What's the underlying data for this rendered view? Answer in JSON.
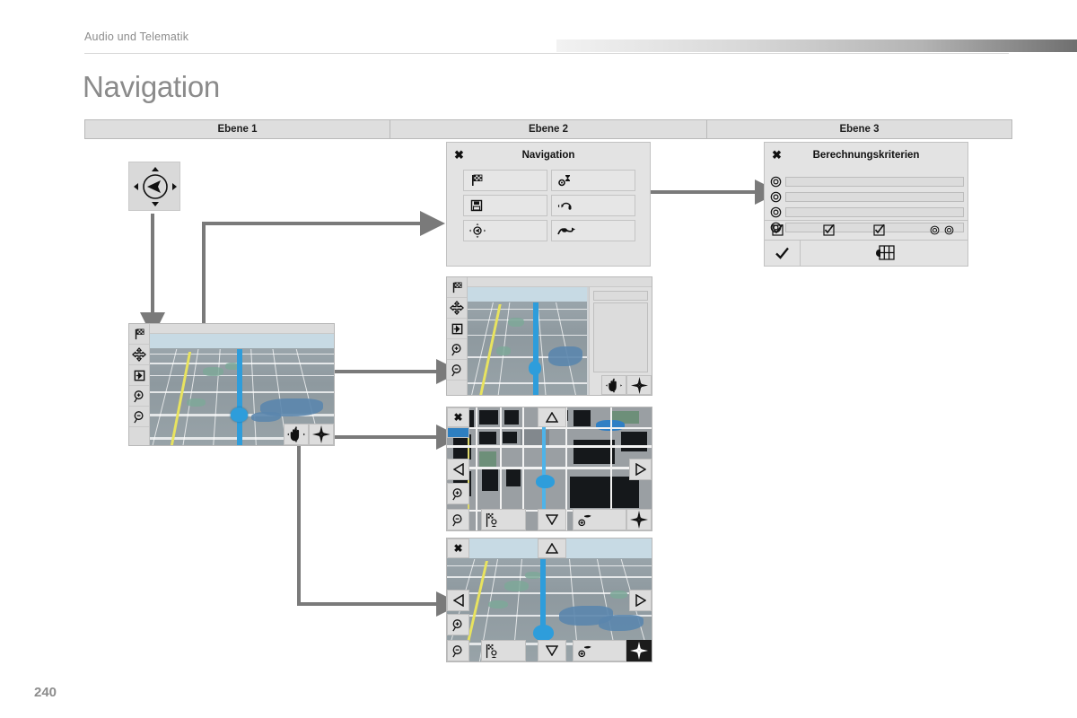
{
  "page": {
    "running_head": "Audio und Telematik",
    "title": "Navigation",
    "number": "240"
  },
  "level_table": {
    "columns": [
      {
        "label": "Ebene 1"
      },
      {
        "label": "Ebene 2"
      },
      {
        "label": "Ebene 3"
      }
    ]
  },
  "joystick": {
    "name": "compass-joystick",
    "icon": "compass-pointer-icon"
  },
  "nav_dialog": {
    "title": "Navigation",
    "close_label": "✖",
    "buttons": [
      {
        "icon": "checkered-flag-icon",
        "label": ""
      },
      {
        "icon": "calculation-criteria-icon",
        "label": ""
      },
      {
        "icon": "floppy-save-icon",
        "label": ""
      },
      {
        "icon": "traffic-headset-icon",
        "label": ""
      },
      {
        "icon": "gps-compass-icon",
        "label": ""
      },
      {
        "icon": "route-road-icon",
        "label": ""
      }
    ]
  },
  "calc_dialog": {
    "title": "Berechnungskriterien",
    "close_label": "✖",
    "option_rows": [
      {
        "icon": "radio-button-icon",
        "value": ""
      },
      {
        "icon": "radio-button-icon",
        "value": ""
      },
      {
        "icon": "radio-button-icon",
        "value": ""
      },
      {
        "icon": "radio-button-icon",
        "value": ""
      }
    ],
    "toggle_icons": [
      {
        "icon": "checkbox-checked-icon"
      },
      {
        "icon": "checkbox-checked-icon"
      },
      {
        "icon": "checkbox-checked-icon"
      }
    ],
    "radio_icons": [
      {
        "icon": "radio-button-icon"
      },
      {
        "icon": "radio-button-icon"
      }
    ],
    "footer": {
      "confirm_icon": "checkmark-icon",
      "map_icon": "map-grid-hand-icon"
    }
  },
  "maps": {
    "main_3d": {
      "name": "map-screen-3d-main",
      "sidebar": [
        {
          "icon": "checkered-flag-icon"
        },
        {
          "icon": "move-cross-icon"
        },
        {
          "icon": "exit-arrow-icon"
        },
        {
          "icon": "zoom-in-icon"
        },
        {
          "icon": "zoom-out-icon"
        }
      ],
      "corner_buttons": [
        {
          "icon": "hand-pan-icon"
        },
        {
          "icon": "compass-rose-icon"
        }
      ]
    },
    "split_3d": {
      "name": "map-screen-3d-split",
      "sidebar": [
        {
          "icon": "checkered-flag-icon"
        },
        {
          "icon": "move-cross-icon"
        },
        {
          "icon": "exit-arrow-icon"
        },
        {
          "icon": "zoom-in-icon"
        },
        {
          "icon": "zoom-out-icon"
        }
      ],
      "corner_buttons": [
        {
          "icon": "hand-pan-icon"
        },
        {
          "icon": "compass-rose-icon"
        }
      ]
    },
    "pan_2d": {
      "name": "map-screen-2d-pan",
      "close_label": "✖",
      "sidebar": [
        {
          "icon": "scale-bar-icon"
        },
        {
          "icon": "pan-left-icon"
        },
        {
          "icon": "zoom-in-icon"
        },
        {
          "icon": "zoom-out-icon"
        }
      ],
      "pan_up_icon": "pan-up-icon",
      "pan_down_icon": "pan-down-icon",
      "pan_left_icon": "pan-left-icon",
      "pan_right_icon": "pan-right-icon",
      "toolbar": [
        {
          "icon": "poi-flags-icon"
        },
        {
          "icon": "add-waypoint-flag-icon"
        },
        {
          "icon": "compass-rose-icon"
        }
      ]
    },
    "pan_3d": {
      "name": "map-screen-3d-pan",
      "close_label": "✖",
      "sidebar": [
        {
          "icon": "pan-left-icon"
        },
        {
          "icon": "zoom-in-icon"
        },
        {
          "icon": "zoom-out-icon"
        }
      ],
      "pan_up_icon": "pan-up-icon",
      "pan_down_icon": "pan-down-icon",
      "pan_left_icon": "pan-left-icon",
      "pan_right_icon": "pan-right-icon",
      "toolbar": [
        {
          "icon": "poi-flags-icon"
        },
        {
          "icon": "add-waypoint-flag-icon"
        },
        {
          "icon": "compass-rose-dark-icon"
        }
      ]
    }
  },
  "connectors": {
    "color": "#7a7a7a",
    "arrows": [
      {
        "name": "joystick-to-main-map",
        "direction": "down"
      },
      {
        "name": "main-map-to-nav-dialog",
        "direction": "right"
      },
      {
        "name": "nav-dialog-to-calc-dialog",
        "direction": "right"
      },
      {
        "name": "main-map-to-split-map",
        "direction": "right"
      },
      {
        "name": "main-map-to-pan-2d-map",
        "direction": "right"
      },
      {
        "name": "main-map-to-pan-3d-map",
        "direction": "right"
      }
    ]
  },
  "colors": {
    "accent_route": "#2e9ddb",
    "header_bg": "#dedede",
    "panel_bg": "#e3e3e3",
    "title_gray": "#8b8b8b",
    "connector_gray": "#7a7a7a"
  }
}
